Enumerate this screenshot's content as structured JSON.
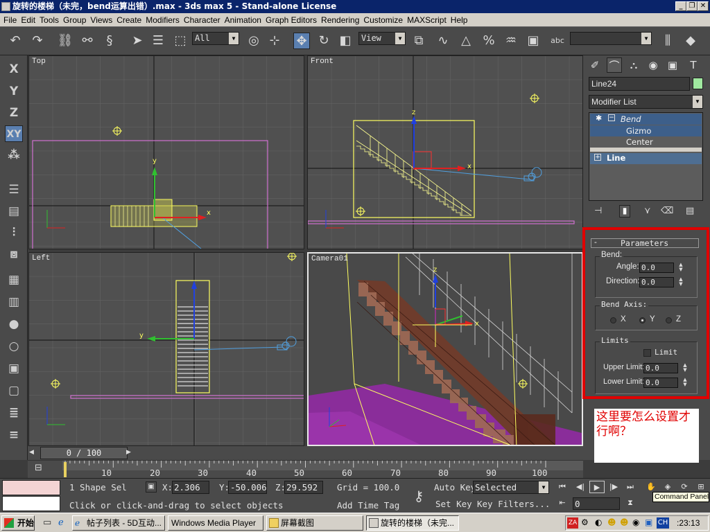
{
  "window": {
    "title": "旋转的楼梯（未完，bend运算出错）.max - 3ds max 5 - Stand-alone License",
    "min_label": "_",
    "restore_label": "❐",
    "close_label": "✕"
  },
  "menu": [
    "File",
    "Edit",
    "Tools",
    "Group",
    "Views",
    "Create",
    "Modifiers",
    "Character",
    "Animation",
    "Graph Editors",
    "Rendering",
    "Customize",
    "MAXScript",
    "Help"
  ],
  "toolbar": {
    "selection_filter": "All",
    "ref_coord": "View",
    "named_selection": ""
  },
  "left_toolbar": [
    "X",
    "Y",
    "Z",
    "XY"
  ],
  "viewports": {
    "top": "Top",
    "front": "Front",
    "left": "Left",
    "camera": "Camera01"
  },
  "axis_labels": {
    "x": "x",
    "y": "y",
    "z": "z"
  },
  "command_panel": {
    "object_name": "Line24",
    "object_color": "#a0e8a0",
    "modifier_list": "Modifier List",
    "stack": {
      "bend": "Bend",
      "gizmo": "Gizmo",
      "center": "Center",
      "line": "Line"
    },
    "parameters": {
      "title": "Parameters",
      "bend_group": "Bend:",
      "angle_label": "Angle:",
      "angle_value": "0.0",
      "direction_label": "Direction:",
      "direction_value": "0.0",
      "axis_group": "Bend Axis:",
      "axes": [
        "X",
        "Y",
        "Z"
      ],
      "selected_axis": "Y",
      "limits_group": "Limits",
      "limit_label": "Limit",
      "limit_checked": false,
      "upper_label": "Upper Limit:",
      "upper_value": "0.0",
      "lower_label": "Lower Limit:",
      "lower_value": "0.0"
    },
    "note": "这里要怎么设置才行啊？",
    "highlight_color": "#e00000"
  },
  "timeline": {
    "frame": "0 / 100",
    "ticks": [
      "10",
      "20",
      "30",
      "40",
      "50",
      "60",
      "70",
      "80",
      "90",
      "100"
    ]
  },
  "status": {
    "selection": "1 Shape Sel",
    "x_label": "X:",
    "x_value": "2.306",
    "y_label": "Y:",
    "y_value": "-50.006",
    "z_label": "Z:",
    "z_value": "29.592",
    "grid": "Grid = 100.0",
    "prompt": "Click or click-and-drag to select objects",
    "add_time_tag": "Add Time Tag",
    "auto_key": "Auto Key",
    "set_key": "Set Key",
    "selected": "Selected",
    "key_filters": "Key Filters...",
    "current_frame": "0",
    "tooltip": "Command Panel"
  },
  "taskbar": {
    "start": "开始",
    "tasks": [
      "帖子列表 - 5D互动...",
      "Windows Media Player",
      "屏幕截图",
      "旋转的楼梯（未完..."
    ],
    "clock": ":23:13",
    "tray_ch": "CH"
  }
}
